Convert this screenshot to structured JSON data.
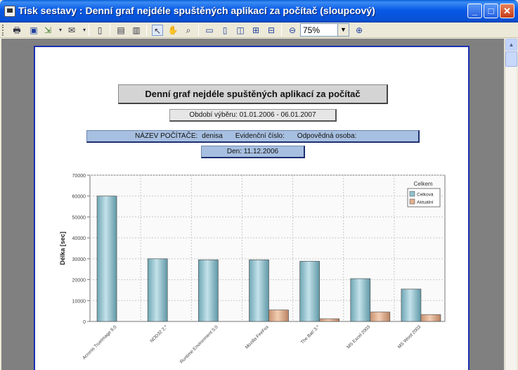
{
  "window": {
    "title": "Tisk sestavy : Denní graf nejdéle spuštěných aplikací za počítač (sloupcový)",
    "minimize_glyph": "_",
    "maximize_glyph": "□",
    "close_glyph": "✕"
  },
  "toolbar": {
    "zoom_value": "75%",
    "zoom_out_glyph": "⊖",
    "zoom_in_glyph": "⊕",
    "tools": [
      "print-icon",
      "save-icon",
      "export-icon",
      "send-icon",
      "page-setup-icon",
      "thumbnails-icon",
      "outline-icon",
      "select-icon",
      "hand-icon",
      "find-icon",
      "single-page-icon",
      "continuous-icon",
      "facing-icon",
      "multi-page-icon",
      "fit-icon"
    ]
  },
  "report": {
    "title": "Denní graf nejdéle spuštěných aplikací za počítač",
    "period": "Období výběru:  01.01.2006  -  06.01.2007",
    "computer_label": "NÁZEV  POČÍTAČE:",
    "computer_value": "denisa",
    "evidence_label": "Evidenční číslo:",
    "person_label": "Odpovědná osoba:",
    "day": "Den:  11.12.2006"
  },
  "chart_data": {
    "type": "bar",
    "categories": [
      "Acronis TrueImage  8.0",
      "NOD32  2.*",
      "Runtime Environment  5.0",
      "Mozilla FireFox",
      "The Bat!  3.*",
      "MS Excel  2003",
      "MS Word  2003"
    ],
    "series": [
      {
        "name": "Celková",
        "color": "#8fc3cf",
        "values": [
          60000,
          30000,
          29500,
          29500,
          28800,
          20500,
          15500
        ]
      },
      {
        "name": "Aktuální",
        "color": "#e2b18f",
        "values": [
          0,
          0,
          0,
          5500,
          1300,
          4500,
          3300
        ]
      }
    ],
    "ylabel": "Délka  [sec]",
    "ylim": [
      0,
      70000
    ],
    "yticks": [
      0,
      10000,
      20000,
      30000,
      40000,
      50000,
      60000,
      70000
    ],
    "legend_title": "Celkem",
    "legend_position": "top-right",
    "grid": true
  }
}
